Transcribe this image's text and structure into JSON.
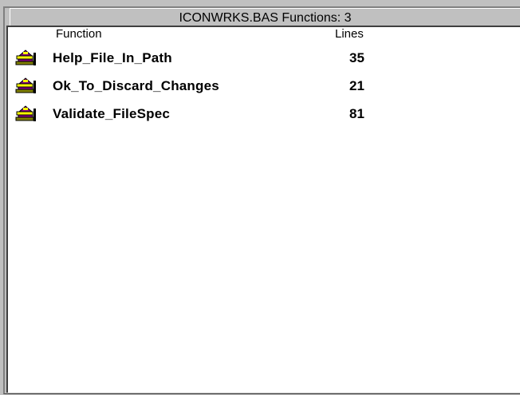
{
  "caption": "ICONWRKS.BAS Functions: 3",
  "columns": {
    "function": "Function",
    "lines": "Lines"
  },
  "rows": [
    {
      "name": "Help_File_In_Path",
      "lines": "35",
      "icon": "function-icon"
    },
    {
      "name": "Ok_To_Discard_Changes",
      "lines": "21",
      "icon": "function-icon"
    },
    {
      "name": "Validate_FileSpec",
      "lines": "81",
      "icon": "function-icon"
    }
  ],
  "colors": {
    "background": "#c0c0c0",
    "list_background": "#ffffff",
    "icon_purple": "#800080",
    "icon_yellow": "#ffff00",
    "icon_olive": "#808000"
  }
}
